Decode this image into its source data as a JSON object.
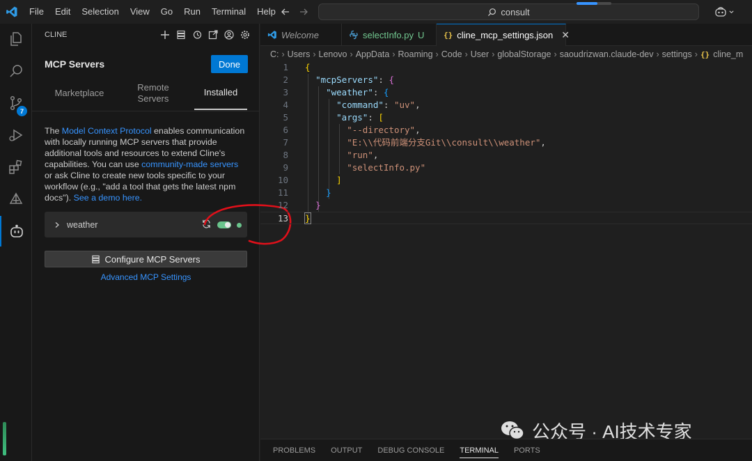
{
  "menu": [
    "File",
    "Edit",
    "Selection",
    "View",
    "Go",
    "Run",
    "Terminal",
    "Help"
  ],
  "search": {
    "text": "consult"
  },
  "activity_bar": {
    "icons": [
      "files-icon",
      "search-icon",
      "source-control-icon",
      "run-debug-icon",
      "extensions-icon",
      "remote-icon",
      "cline-icon"
    ],
    "scm_badge": "7"
  },
  "sidebar": {
    "title": "CLINE",
    "heading": "MCP Servers",
    "done_label": "Done",
    "tabs": [
      "Marketplace",
      "Remote Servers",
      "Installed"
    ],
    "active_tab": "Installed",
    "description": {
      "p1": "The ",
      "link1": "Model Context Protocol",
      "p2": " enables communication with locally running MCP servers that provide additional tools and resources to extend Cline's capabilities. You can use ",
      "link2": "community-made servers",
      "p3": " or ask Cline to create new tools specific to your workflow (e.g., \"add a tool that gets the latest npm docs\"). ",
      "link3": "See a demo here."
    },
    "server": {
      "name": "weather",
      "enabled": true,
      "status_color": "#6ac48c"
    },
    "configure_label": "Configure MCP Servers",
    "advanced_label": "Advanced MCP Settings"
  },
  "editor": {
    "tabs": [
      {
        "label": "Welcome"
      },
      {
        "label": "selectInfo.py",
        "badge": "U"
      },
      {
        "label": "cline_mcp_settings.json",
        "close": "✕"
      }
    ],
    "breadcrumb": [
      "C:",
      "Users",
      "Lenovo",
      "AppData",
      "Roaming",
      "Code",
      "User",
      "globalStorage",
      "saoudrizwan.claude-dev",
      "settings",
      "cline_m"
    ],
    "line_numbers": [
      "1",
      "2",
      "3",
      "4",
      "5",
      "6",
      "7",
      "8",
      "9",
      "10",
      "11",
      "12",
      "13"
    ],
    "current_line": "13",
    "code": {
      "l1_open": "{",
      "mcp_key": "\"mcpServers\"",
      "weather_key": "\"weather\"",
      "command_key": "\"command\"",
      "command_val": "\"uv\"",
      "args_key": "\"args\"",
      "arg1": "\"--directory\"",
      "arg2": "\"E:\\\\代码前端分支Git\\\\consult\\\\weather\"",
      "arg3": "\"run\"",
      "arg4": "\"selectInfo.py\""
    }
  },
  "panel_tabs": [
    "PROBLEMS",
    "OUTPUT",
    "DEBUG CONSOLE",
    "TERMINAL",
    "PORTS"
  ],
  "active_panel_tab": "TERMINAL",
  "watermark": "公众号 · AI技术专家",
  "colors": {
    "accent": "#0078d4",
    "link": "#3794ff",
    "toggle_on": "#6ac48c",
    "annotation": "#e0101a"
  }
}
